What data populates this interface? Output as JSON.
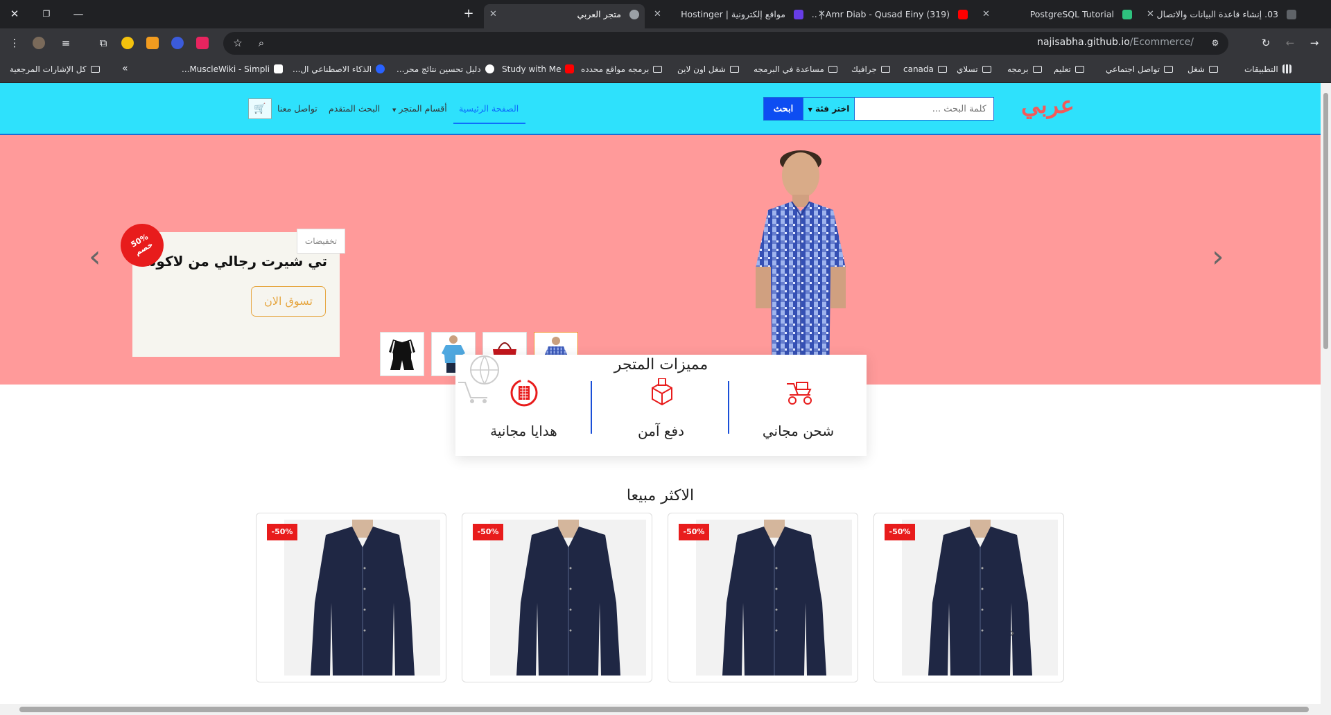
{
  "browser": {
    "tabs": [
      {
        "title": "03. إنشاء قاعدة البيانات والاتصال",
        "icon_color": "#8ab4f8"
      },
      {
        "title": "PostgreSQL Tutorial",
        "icon_color": "#2ec27e"
      },
      {
        "title": "(319) Amr Diab - Qusad Einy | ...",
        "icon_color": "#ff0000"
      },
      {
        "title": "مواقع إلكترونية | Hostinger",
        "icon_color": "#673de6"
      },
      {
        "title": "متجر العربي",
        "icon_color": "#9aa0a6",
        "active": true
      }
    ],
    "url_host": "najisabha.github.io",
    "url_path": "/Ecommerce/",
    "bookmarks": [
      {
        "label": "التطبيقات",
        "type": "apps"
      },
      {
        "label": "شغل",
        "type": "folder"
      },
      {
        "label": "تواصل اجتماعي",
        "type": "folder"
      },
      {
        "label": "تعليم",
        "type": "folder"
      },
      {
        "label": "برمجه",
        "type": "folder"
      },
      {
        "label": "تسلاي",
        "type": "folder"
      },
      {
        "label": "canada",
        "type": "folder"
      },
      {
        "label": "جرافيك",
        "type": "folder"
      },
      {
        "label": "مساعدة في البرمجه",
        "type": "folder"
      },
      {
        "label": "شغل اون لاين",
        "type": "folder"
      },
      {
        "label": "برمجه مواقع محدده",
        "type": "folder"
      },
      {
        "label": "Study with Me",
        "type": "youtube"
      },
      {
        "label": "دليل تحسين نتائج محر...",
        "type": "google"
      },
      {
        "label": "الذكاء الاصطناعي ال...",
        "type": "c"
      },
      {
        "label": "MuscleWiki - Simpli...",
        "type": "mw"
      },
      {
        "label": "كل الإشارات المرجعية",
        "type": "folder"
      }
    ],
    "more_label": "»"
  },
  "site": {
    "logo": "عربي",
    "search": {
      "placeholder": "كلمة البحث ...",
      "category_label": "اختر فئة",
      "button_label": "ابحث"
    },
    "nav": {
      "home": "الصفحة الرئيسية",
      "categories": "أقسام المتجر",
      "advanced": "البحث المتقدم",
      "contact": "تواصل معنا"
    }
  },
  "hero": {
    "tag": "تخفيضات",
    "title": "تي شيرت رجالي من لاكوست",
    "button": "تسوق الان",
    "badge_percent": "50%",
    "badge_word": "خصم"
  },
  "features": {
    "title": "مميزات المتجر",
    "items": [
      {
        "label": "شحن مجاني",
        "icon": "delivery-scooter-icon"
      },
      {
        "label": "دفع آمن",
        "icon": "secure-box-icon"
      },
      {
        "label": "هدايا مجانية",
        "icon": "gift-icon"
      }
    ]
  },
  "best_sellers": {
    "title": "الاكثر مبيعا",
    "products": [
      {
        "badge": "-50%"
      },
      {
        "badge": "-50%"
      },
      {
        "badge": "-50%"
      },
      {
        "badge": "-50%"
      }
    ]
  },
  "colors": {
    "header_bg": "#2ee1fc",
    "hero_bg": "#ff9a9a",
    "primary": "#0d4df2",
    "accent_red": "#e81c1c",
    "logo": "#f25a5a"
  }
}
